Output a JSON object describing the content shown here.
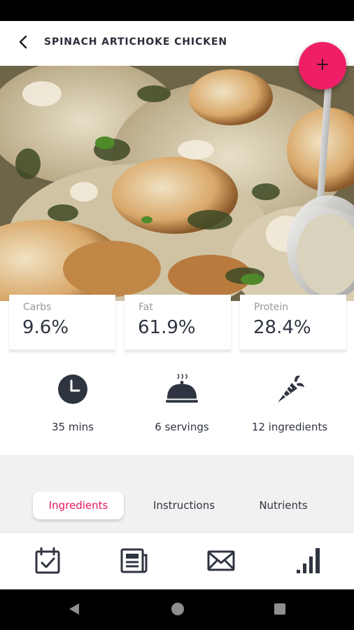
{
  "header": {
    "title": "SPINACH ARTICHOKE CHICKEN",
    "back_icon": "back-arrow-icon",
    "fab_icon": "plus-icon",
    "accent_color": "#ee1f66"
  },
  "macros": [
    {
      "label": "Carbs",
      "value": "9.6%"
    },
    {
      "label": "Fat",
      "value": "61.9%"
    },
    {
      "label": "Protein",
      "value": "28.4%"
    }
  ],
  "stats": {
    "time": {
      "icon": "clock-icon",
      "text": "35 mins"
    },
    "servings": {
      "icon": "serving-cloche-icon",
      "text": "6 servings"
    },
    "ingredients": {
      "icon": "carrot-icon",
      "text": "12 ingredients"
    }
  },
  "tabs": [
    {
      "label": "Ingredients",
      "active": true
    },
    {
      "label": "Instructions",
      "active": false
    },
    {
      "label": "Nutrients",
      "active": false
    }
  ],
  "bottom_nav": [
    {
      "icon": "calendar-check-icon"
    },
    {
      "icon": "newspaper-icon"
    },
    {
      "icon": "envelope-icon"
    },
    {
      "icon": "bar-chart-icon"
    }
  ],
  "system_nav": [
    {
      "icon": "system-back-icon"
    },
    {
      "icon": "system-home-icon"
    },
    {
      "icon": "system-recents-icon"
    }
  ]
}
